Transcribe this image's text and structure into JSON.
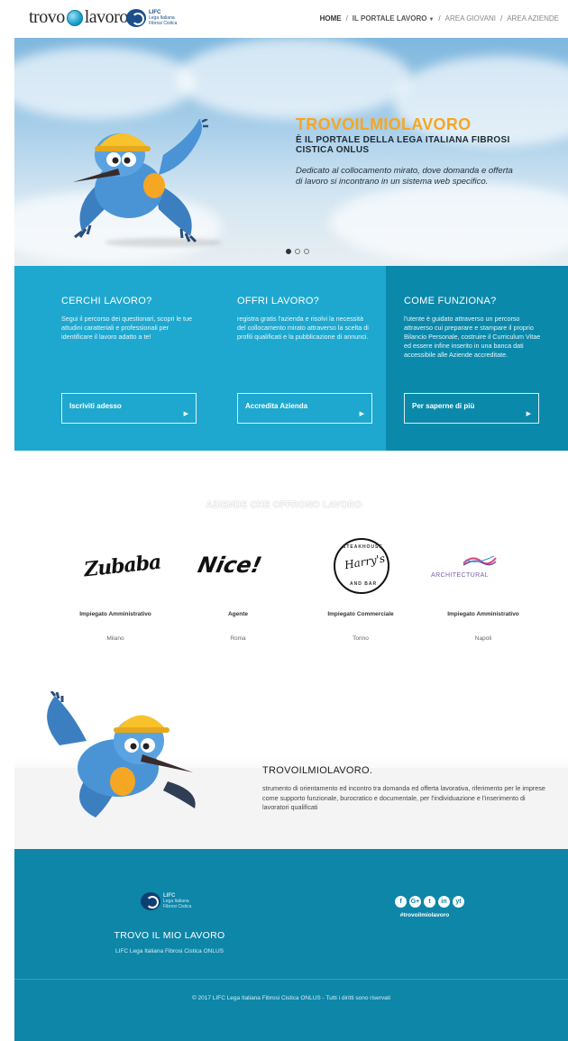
{
  "header": {
    "brand_left": "trovo",
    "brand_right": "lavoro",
    "lifc_small": "LIFC",
    "lifc_line1": "Lega Italiana",
    "lifc_line2": "Fibrosi Cistica",
    "nav": [
      "HOME",
      "IL PORTALE LAVORO",
      "AREA GIOVANI",
      "AREA AZIENDE"
    ]
  },
  "hero": {
    "title": "TROVOILMIOLAVORO",
    "subtitle": "È IL PORTALE DELLA LEGA ITALIANA FIBROSI CISTICA ONLUS",
    "description": "Dedicato al collocamento mirato, dove domanda e offerta di lavoro si incontrano in un sistema web specifico.",
    "slides": 3,
    "active_slide": 1
  },
  "cta": [
    {
      "title": "CERCHI LAVORO?",
      "text": "Segui il percorso dei questionari, scopri le tue attudini caratteriali e professionali per identificare il lavoro adatto a te!",
      "button": "Iscriviti adesso"
    },
    {
      "title": "OFFRI LAVORO?",
      "text": "registra gratis l'azienda e risolvi la necessità del collocamento mirato attraverso la scelta di profili qualificati e la pubblicazione di annunci.",
      "button": "Accredita Azienda"
    },
    {
      "title": "COME FUNZIONA?",
      "text": "l'utente è guidato attraverso un percorso attraverso cui preparare e stampare il proprio Bilancio Personale, costruire il Curriculum Vitae ed essere infine inserito in una banca dati accessibile alle Aziende accreditate.",
      "button": "Per saperne di più"
    }
  ],
  "companies": {
    "title": "AZIENDE CHE OFFRONO LAVORO",
    "items": [
      {
        "brand": "Zubaba",
        "job": "Impiegato Amministrativo",
        "city": "Milano"
      },
      {
        "brand": "Nice!",
        "job": "Agente",
        "city": "Roma"
      },
      {
        "brand": "Harry's",
        "brand_top": "STEAKHOUSE",
        "brand_bottom": "AND BAR",
        "job": "Impiegato Commerciale",
        "city": "Torino"
      },
      {
        "brand": "ARCHITECTURAL",
        "job": "Impiegato Amministrativo",
        "city": "Napoli"
      }
    ]
  },
  "about": {
    "title": "TROVOILMIOLAVORO.",
    "text": "strumento di orientamento ed incontro tra domanda ed offerta lavorativa, riferimento per le imprese come supporto funzionale, burocratico e documentale, per l'individuazione e l'inserimento di lavoratori qualificati"
  },
  "footer": {
    "lifc_small": "LIFC",
    "lifc_line1": "Lega Italiana",
    "lifc_line2": "Fibrosi Cistica",
    "title": "TROVO IL MIO LAVORO",
    "subtitle": "LIFC Lega Italiana Fibrosi Cistica ONLUS",
    "social": [
      "f",
      "G+",
      "t",
      "in",
      "yt"
    ],
    "hashtag": "#trovoilmiolavoro",
    "copyright": "© 2017 LIFC Lega Italiana Fibrosi Cistica ONLUS - Tutti i diritti sono riservati"
  },
  "colors": {
    "accent": "#f5a623",
    "cta_blue": "#1ea8cf",
    "cta_dark": "#0b89ab",
    "footer_blue": "#0d86a8"
  }
}
